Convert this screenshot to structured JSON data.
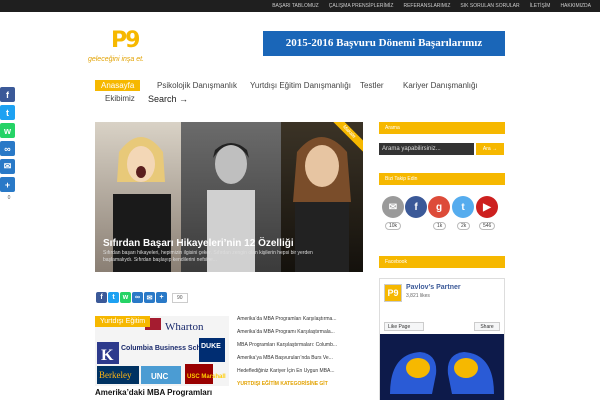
{
  "topnav": [
    "BAŞARI TABLOMUZ",
    "ÇALIŞMA PRENSİPLERİMİZ",
    "REFERANSLARIMIZ",
    "SIK SORULAN SORULAR",
    "İLETİŞİM",
    "HAKKIMIZDA"
  ],
  "logo": {
    "mark": "P9",
    "text": "geleceğini inşa et."
  },
  "banner": "2015-2016 Başvuru Dönemi Başarılarımız",
  "nav": {
    "items": [
      "Anasayfa",
      "Psikolojik Danışmanlık",
      "Yurtdışı Eğitim Danışmanlığı",
      "Testler",
      "Kariyer Danışmanlığı",
      "Ekibimiz"
    ],
    "search": "Search →"
  },
  "slider": {
    "title": "Sıfırdan Başarı Hikayeleri’nin 12 Özelliği",
    "text": "Sıfırdan başarı hikayeleri, hepimizin ilgisini çeker. Sıfırdan zengin olan kişilerin hepsi bir yerden başlamalıydı. Sıfırdan başlayıp kendilerini nefsine...",
    "ribbon": "Makale"
  },
  "share": {
    "count": "90"
  },
  "left_share": {
    "count": "0"
  },
  "box": {
    "tag": "Yurtdışı Eğitim",
    "title": "Amerika’daki MBA Programları",
    "logos": [
      "Wharton",
      "Columbia Business School",
      "Berkeley",
      "UNC",
      "USC Marshall",
      "DUKE"
    ]
  },
  "links": [
    "Amerika’da MBA Programları Karşılaştırma...",
    "Amerika’da MBA Programı Karşılaştırmala...",
    "MBA Programları Karşılaştırmaları: Columb...",
    "Amerika’ya MBA Başvuruları’nda Burs Ve...",
    "Hedeflediğiniz Kariyer İçin En Uygun MBA..."
  ],
  "category": "YURTDIŞI EĞİTİM KATEGORİSİNE GİT",
  "sidebar": {
    "arama": "Arama",
    "search_placeholder": "Arama yapabilirsiniz...",
    "search_btn": "Ara →",
    "follow": "Bizi Takip Edin",
    "facebook": "Facebook",
    "badges": [
      "10k",
      "1k",
      "2k",
      "546"
    ],
    "page": "Pavlov’s Partner",
    "likes": "3,821 likes",
    "like_btn": "Like Page",
    "share_btn": "Share"
  }
}
